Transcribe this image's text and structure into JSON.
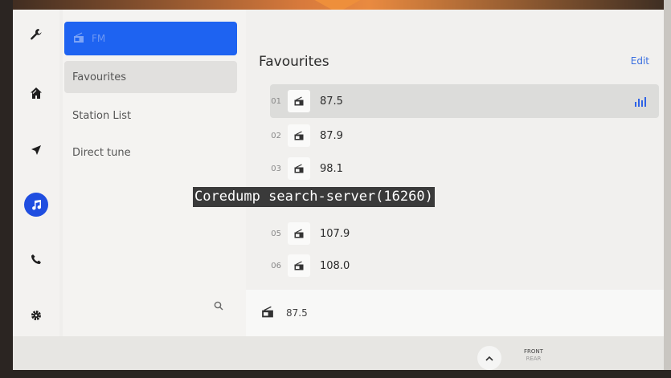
{
  "source": {
    "label": "FM"
  },
  "sidebar": {
    "items": [
      {
        "label": "Favourites",
        "active": true
      },
      {
        "label": "Station List",
        "active": false
      },
      {
        "label": "Direct tune",
        "active": false
      }
    ]
  },
  "rail": {
    "icons": [
      "wrench-icon",
      "home-icon",
      "navigation-icon",
      "music-icon",
      "phone-icon",
      "gear-icon"
    ],
    "active": "music-icon"
  },
  "main": {
    "title": "Favourites",
    "edit_label": "Edit",
    "rows": [
      {
        "num": "01",
        "freq": "87.5",
        "playing": true
      },
      {
        "num": "02",
        "freq": "87.9",
        "playing": false
      },
      {
        "num": "03",
        "freq": "98.1",
        "playing": false
      },
      {
        "num": "05",
        "freq": "107.9",
        "playing": false
      },
      {
        "num": "06",
        "freq": "108.0",
        "playing": false
      }
    ]
  },
  "now_playing": {
    "freq": "87.5"
  },
  "bottom": {
    "front_label": "FRONT",
    "rear_label": "REAR"
  },
  "error": {
    "text": "Coredump search-server(16260)"
  },
  "colors": {
    "accent": "#1e63f1",
    "music_active": "#1f4ee0",
    "edit": "#3a6fe0",
    "bezel_arrow": "#ee8f3b"
  }
}
